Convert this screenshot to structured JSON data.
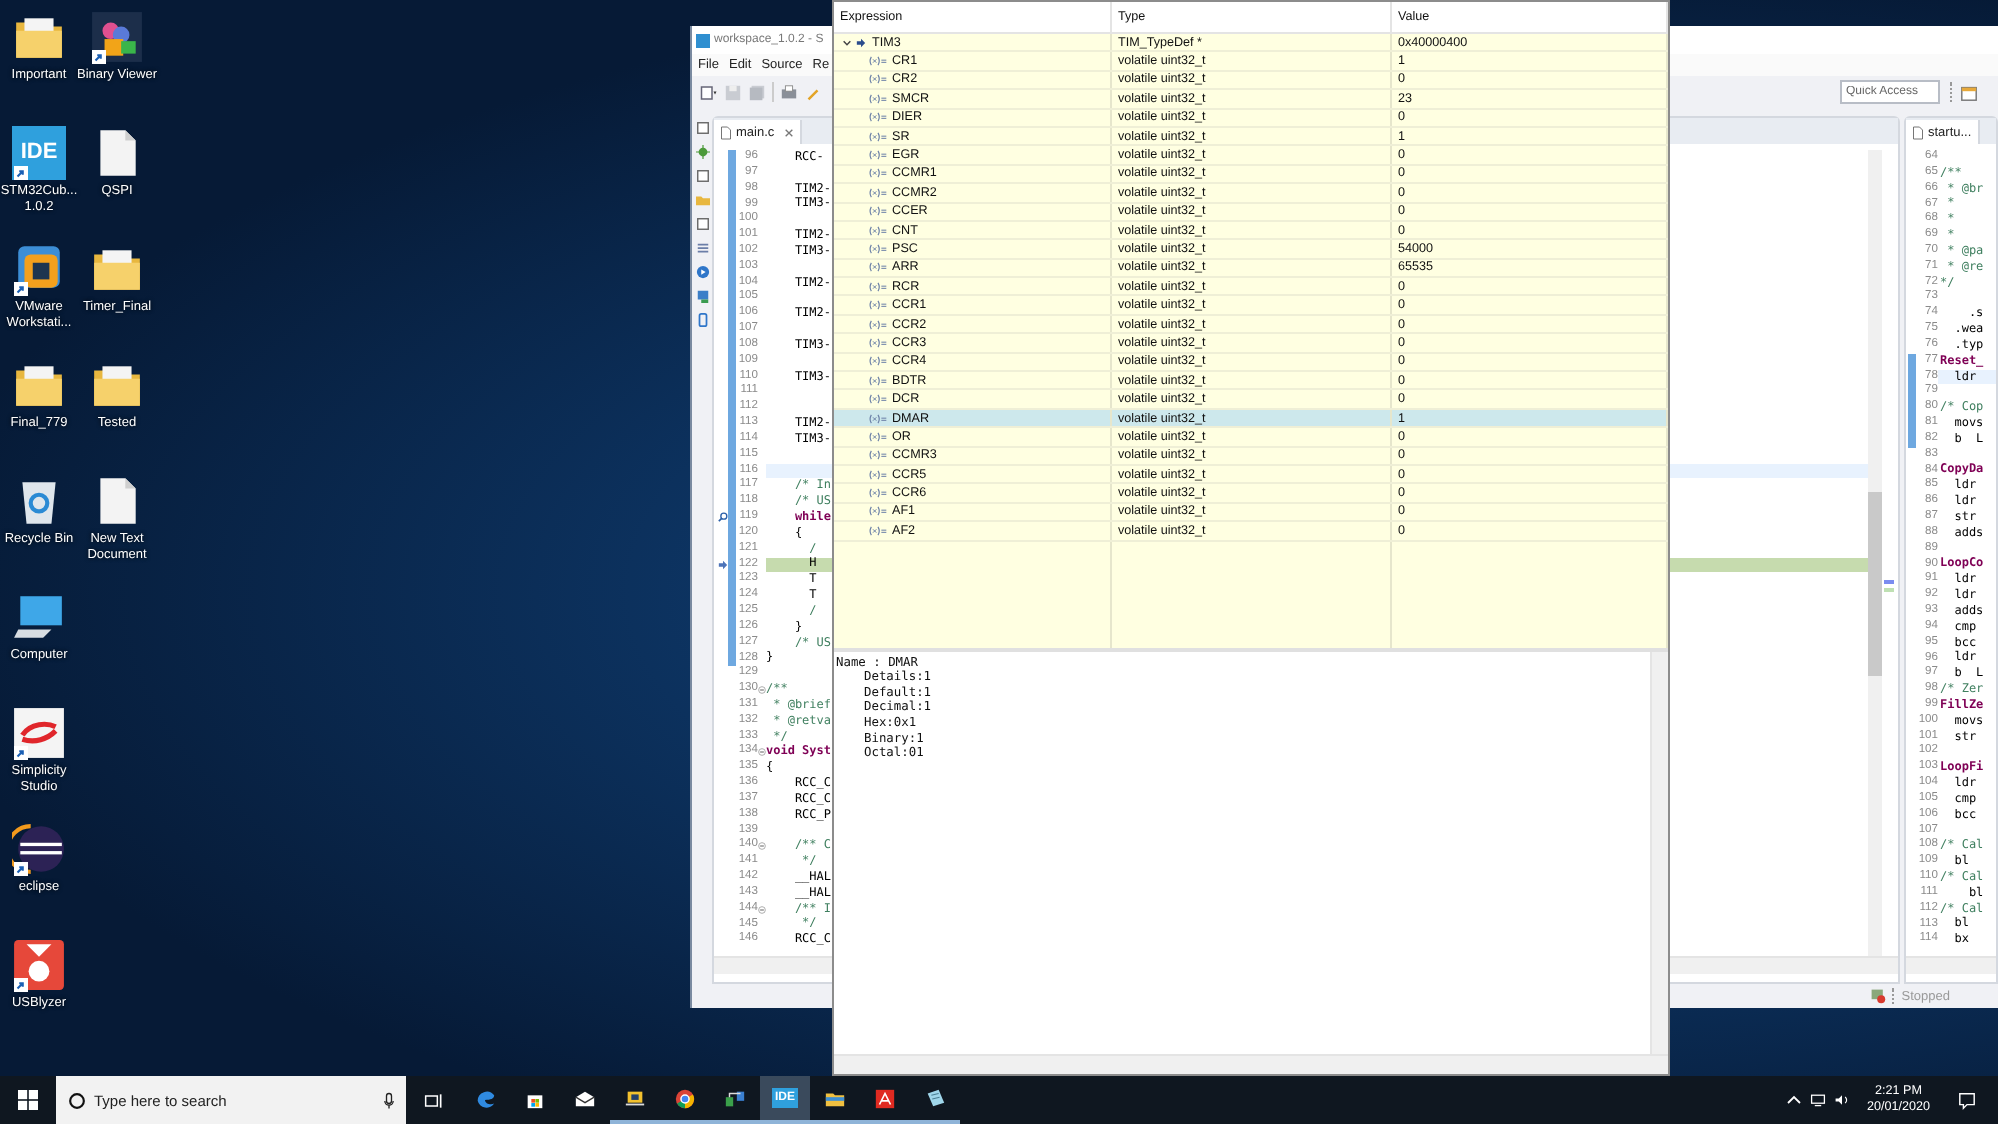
{
  "desktop_icon_rows": [
    [
      {
        "kind": "folder",
        "label": "Important",
        "shortcut": false
      },
      {
        "kind": "binary",
        "label": "Binary Viewer",
        "shortcut": true
      }
    ],
    [
      {
        "kind": "ide",
        "badge": "IDE",
        "label": "STM32Cub... 1.0.2",
        "shortcut": true
      },
      {
        "kind": "file",
        "label": "QSPI",
        "shortcut": false
      }
    ],
    [
      {
        "kind": "vmware",
        "label": "VMware Workstati...",
        "shortcut": true
      },
      {
        "kind": "folder",
        "label": "Timer_Final",
        "shortcut": false
      }
    ],
    [
      {
        "kind": "folder",
        "label": "Final_779",
        "shortcut": false
      },
      {
        "kind": "folder",
        "label": "Tested",
        "shortcut": false
      }
    ],
    [
      {
        "kind": "recycle",
        "label": "Recycle Bin",
        "shortcut": false
      },
      {
        "kind": "file",
        "label": "New Text Document",
        "shortcut": false
      }
    ],
    [
      {
        "kind": "computer",
        "label": "Computer",
        "shortcut": false
      }
    ],
    [
      {
        "kind": "simplicity",
        "label": "Simplicity Studio",
        "shortcut": true
      }
    ],
    [
      {
        "kind": "eclipse",
        "label": "eclipse",
        "shortcut": true
      }
    ],
    [
      {
        "kind": "usblyzer",
        "label": "USBlyzer",
        "shortcut": true
      }
    ]
  ],
  "ide_window": {
    "title": "workspace_1.0.2 - S",
    "menu": [
      "File",
      "Edit",
      "Source",
      "Re"
    ],
    "quick_access": {
      "placeholder": "Quick Access"
    },
    "main_editor": {
      "tab": "main.c",
      "lines": [
        {
          "n": "96",
          "text": "    RCC-",
          "kind": "code",
          "bar": true
        },
        {
          "n": "97",
          "bar": true
        },
        {
          "n": "98",
          "text": "    TIM2-",
          "kind": "code",
          "bar": true
        },
        {
          "n": "99",
          "text": "    TIM3-",
          "kind": "code",
          "bar": true
        },
        {
          "n": "100",
          "bar": true
        },
        {
          "n": "101",
          "text": "    TIM2-",
          "kind": "code",
          "bar": true
        },
        {
          "n": "102",
          "text": "    TIM3-",
          "kind": "code",
          "bar": true
        },
        {
          "n": "103",
          "bar": true
        },
        {
          "n": "104",
          "text": "    TIM2-",
          "kind": "code",
          "bar": true
        },
        {
          "n": "105",
          "bar": true
        },
        {
          "n": "106",
          "text": "    TIM2-",
          "kind": "code",
          "bar": true
        },
        {
          "n": "107",
          "bar": true
        },
        {
          "n": "108",
          "text": "    TIM3-",
          "kind": "code",
          "bar": true
        },
        {
          "n": "109",
          "bar": true
        },
        {
          "n": "110",
          "text": "    TIM3-",
          "kind": "code",
          "bar": true
        },
        {
          "n": "111",
          "bar": true
        },
        {
          "n": "112",
          "bar": true
        },
        {
          "n": "113",
          "text": "    TIM2-",
          "kind": "code",
          "bar": true
        },
        {
          "n": "114",
          "text": "    TIM3-",
          "kind": "code",
          "bar": true
        },
        {
          "n": "115",
          "bar": true
        },
        {
          "n": "116",
          "bar": true,
          "cursor_line": true
        },
        {
          "n": "117",
          "text": "    /* In",
          "kind": "comment",
          "bar": true
        },
        {
          "n": "118",
          "text": "    /* US",
          "kind": "comment",
          "bar": true
        },
        {
          "n": "119",
          "text": "    while",
          "kind": "keyword",
          "bar": true,
          "search_marker": true
        },
        {
          "n": "120",
          "text": "    {",
          "kind": "code",
          "bar": true
        },
        {
          "n": "121",
          "text": "      /",
          "kind": "comment",
          "bar": true
        },
        {
          "n": "122",
          "text": "      H",
          "kind": "code",
          "bar": true,
          "pc_line": true
        },
        {
          "n": "123",
          "text": "      T",
          "kind": "code",
          "bar": true
        },
        {
          "n": "124",
          "text": "      T",
          "kind": "code",
          "bar": true
        },
        {
          "n": "125",
          "text": "      /",
          "kind": "comment",
          "bar": true
        },
        {
          "n": "126",
          "text": "    }",
          "kind": "code",
          "bar": true
        },
        {
          "n": "127",
          "text": "    /* US",
          "kind": "comment",
          "bar": true
        },
        {
          "n": "128",
          "text": "}",
          "kind": "code",
          "bar": true
        },
        {
          "n": "129"
        },
        {
          "n": "130",
          "text": "/**",
          "kind": "comment",
          "fold": true
        },
        {
          "n": "131",
          "text": " * @brief",
          "kind": "comment"
        },
        {
          "n": "132",
          "text": " * @retva",
          "kind": "comment"
        },
        {
          "n": "133",
          "text": " */",
          "kind": "comment"
        },
        {
          "n": "134",
          "text": "void Syst",
          "kind": "keyword",
          "fold": true
        },
        {
          "n": "135",
          "text": "{",
          "kind": "code"
        },
        {
          "n": "136",
          "text": "    RCC_C",
          "kind": "code"
        },
        {
          "n": "137",
          "text": "    RCC_C",
          "kind": "code"
        },
        {
          "n": "138",
          "text": "    RCC_P",
          "kind": "code"
        },
        {
          "n": "139"
        },
        {
          "n": "140",
          "text": "    /** C",
          "kind": "comment",
          "fold": true
        },
        {
          "n": "141",
          "text": "     */",
          "kind": "comment"
        },
        {
          "n": "142",
          "text": "    __HAL",
          "kind": "code"
        },
        {
          "n": "143",
          "text": "    __HAL",
          "kind": "code"
        },
        {
          "n": "144",
          "text": "    /** I",
          "kind": "comment",
          "fold": true
        },
        {
          "n": "145",
          "text": "     */",
          "kind": "comment"
        },
        {
          "n": "146",
          "text": "    RCC_C",
          "kind": "code"
        }
      ]
    },
    "side_editor": {
      "tab": "startu...",
      "lines": [
        {
          "n": "64"
        },
        {
          "n": "65",
          "text": "/**",
          "kind": "comment"
        },
        {
          "n": "66",
          "text": " * @br",
          "kind": "comment"
        },
        {
          "n": "67",
          "text": " *",
          "kind": "comment"
        },
        {
          "n": "68",
          "text": " *",
          "kind": "comment"
        },
        {
          "n": "69",
          "text": " *",
          "kind": "comment"
        },
        {
          "n": "70",
          "text": " * @pa",
          "kind": "comment"
        },
        {
          "n": "71",
          "text": " * @re",
          "kind": "comment"
        },
        {
          "n": "72",
          "text": "*/",
          "kind": "comment"
        },
        {
          "n": "73"
        },
        {
          "n": "74",
          "text": "    .s",
          "kind": "code"
        },
        {
          "n": "75",
          "text": "  .wea",
          "kind": "code"
        },
        {
          "n": "76",
          "text": "  .typ",
          "kind": "code"
        },
        {
          "n": "77",
          "text": "Reset_",
          "kind": "label",
          "bar": true
        },
        {
          "n": "78",
          "text": "  ldr",
          "kind": "code",
          "bar": true,
          "cursor_line": true
        },
        {
          "n": "79",
          "bar": true
        },
        {
          "n": "80",
          "text": "/* Cop",
          "kind": "comment",
          "bar": true
        },
        {
          "n": "81",
          "text": "  movs",
          "kind": "code",
          "bar": true
        },
        {
          "n": "82",
          "text": "  b  L",
          "kind": "code",
          "bar": true
        },
        {
          "n": "83"
        },
        {
          "n": "84",
          "text": "CopyDa",
          "kind": "label"
        },
        {
          "n": "85",
          "text": "  ldr",
          "kind": "code"
        },
        {
          "n": "86",
          "text": "  ldr",
          "kind": "code"
        },
        {
          "n": "87",
          "text": "  str",
          "kind": "code"
        },
        {
          "n": "88",
          "text": "  adds",
          "kind": "code"
        },
        {
          "n": "89"
        },
        {
          "n": "90",
          "text": "LoopCo",
          "kind": "label"
        },
        {
          "n": "91",
          "text": "  ldr",
          "kind": "code"
        },
        {
          "n": "92",
          "text": "  ldr",
          "kind": "code"
        },
        {
          "n": "93",
          "text": "  adds",
          "kind": "code"
        },
        {
          "n": "94",
          "text": "  cmp",
          "kind": "code"
        },
        {
          "n": "95",
          "text": "  bcc",
          "kind": "code"
        },
        {
          "n": "96",
          "text": "  ldr",
          "kind": "code"
        },
        {
          "n": "97",
          "text": "  b  L",
          "kind": "code"
        },
        {
          "n": "98",
          "text": "/* Zer",
          "kind": "comment"
        },
        {
          "n": "99",
          "text": "FillZe",
          "kind": "label"
        },
        {
          "n": "100",
          "text": "  movs",
          "kind": "code"
        },
        {
          "n": "101",
          "text": "  str",
          "kind": "code"
        },
        {
          "n": "102"
        },
        {
          "n": "103",
          "text": "LoopFi",
          "kind": "label"
        },
        {
          "n": "104",
          "text": "  ldr",
          "kind": "code"
        },
        {
          "n": "105",
          "text": "  cmp",
          "kind": "code"
        },
        {
          "n": "106",
          "text": "  bcc",
          "kind": "code"
        },
        {
          "n": "107"
        },
        {
          "n": "108",
          "text": "/* Cal",
          "kind": "comment"
        },
        {
          "n": "109",
          "text": "  bl",
          "kind": "code"
        },
        {
          "n": "110",
          "text": "/* Cal",
          "kind": "comment"
        },
        {
          "n": "111",
          "text": "    bl",
          "kind": "code"
        },
        {
          "n": "112",
          "text": "/* Cal",
          "kind": "comment"
        },
        {
          "n": "113",
          "text": "  bl",
          "kind": "code"
        },
        {
          "n": "114",
          "text": "  bx",
          "kind": "code"
        }
      ]
    },
    "status": "Stopped"
  },
  "expressions_popup": {
    "columns": [
      "Expression",
      "Type",
      "Value"
    ],
    "root": {
      "name": "TIM3",
      "type": "TIM_TypeDef *",
      "value": "0x40000400",
      "expanded": true,
      "selected": false,
      "children": [
        {
          "name": "CR1",
          "type": "volatile uint32_t",
          "value": "1",
          "selected": false
        },
        {
          "name": "CR2",
          "type": "volatile uint32_t",
          "value": "0",
          "selected": false
        },
        {
          "name": "SMCR",
          "type": "volatile uint32_t",
          "value": "23",
          "selected": false
        },
        {
          "name": "DIER",
          "type": "volatile uint32_t",
          "value": "0",
          "selected": false
        },
        {
          "name": "SR",
          "type": "volatile uint32_t",
          "value": "1",
          "selected": false
        },
        {
          "name": "EGR",
          "type": "volatile uint32_t",
          "value": "0",
          "selected": false
        },
        {
          "name": "CCMR1",
          "type": "volatile uint32_t",
          "value": "0",
          "selected": false
        },
        {
          "name": "CCMR2",
          "type": "volatile uint32_t",
          "value": "0",
          "selected": false
        },
        {
          "name": "CCER",
          "type": "volatile uint32_t",
          "value": "0",
          "selected": false
        },
        {
          "name": "CNT",
          "type": "volatile uint32_t",
          "value": "0",
          "selected": false
        },
        {
          "name": "PSC",
          "type": "volatile uint32_t",
          "value": "54000",
          "selected": false
        },
        {
          "name": "ARR",
          "type": "volatile uint32_t",
          "value": "65535",
          "selected": false
        },
        {
          "name": "RCR",
          "type": "volatile uint32_t",
          "value": "0",
          "selected": false
        },
        {
          "name": "CCR1",
          "type": "volatile uint32_t",
          "value": "0",
          "selected": false
        },
        {
          "name": "CCR2",
          "type": "volatile uint32_t",
          "value": "0",
          "selected": false
        },
        {
          "name": "CCR3",
          "type": "volatile uint32_t",
          "value": "0",
          "selected": false
        },
        {
          "name": "CCR4",
          "type": "volatile uint32_t",
          "value": "0",
          "selected": false
        },
        {
          "name": "BDTR",
          "type": "volatile uint32_t",
          "value": "0",
          "selected": false
        },
        {
          "name": "DCR",
          "type": "volatile uint32_t",
          "value": "0",
          "selected": false
        },
        {
          "name": "DMAR",
          "type": "volatile uint32_t",
          "value": "1",
          "selected": true
        },
        {
          "name": "OR",
          "type": "volatile uint32_t",
          "value": "0",
          "selected": false
        },
        {
          "name": "CCMR3",
          "type": "volatile uint32_t",
          "value": "0",
          "selected": false
        },
        {
          "name": "CCR5",
          "type": "volatile uint32_t",
          "value": "0",
          "selected": false
        },
        {
          "name": "CCR6",
          "type": "volatile uint32_t",
          "value": "0",
          "selected": false
        },
        {
          "name": "AF1",
          "type": "volatile uint32_t",
          "value": "0",
          "selected": false
        },
        {
          "name": "AF2",
          "type": "volatile uint32_t",
          "value": "0",
          "selected": false
        }
      ]
    },
    "details": {
      "heading": "Name : DMAR",
      "fields": [
        "Details:1",
        "Default:1",
        "Decimal:1",
        "Hex:0x1",
        "Binary:1",
        "Octal:01"
      ]
    }
  },
  "taskbar": {
    "search": {
      "placeholder": "Type here to search"
    },
    "apps": [
      {
        "kind": "edge",
        "running": false,
        "active": false
      },
      {
        "kind": "store",
        "running": false,
        "active": false
      },
      {
        "kind": "mail",
        "running": false,
        "active": false
      },
      {
        "kind": "presenter",
        "running": true,
        "active": false
      },
      {
        "kind": "chrome",
        "running": true,
        "active": false
      },
      {
        "kind": "network",
        "running": true,
        "active": false
      },
      {
        "kind": "ide",
        "badge": "IDE",
        "running": true,
        "active": true
      },
      {
        "kind": "explorer",
        "running": true,
        "active": false
      },
      {
        "kind": "acrobat",
        "running": true,
        "active": false
      },
      {
        "kind": "notepad",
        "running": true,
        "active": false
      }
    ],
    "time": "2:21 PM",
    "date": "20/01/2020"
  }
}
